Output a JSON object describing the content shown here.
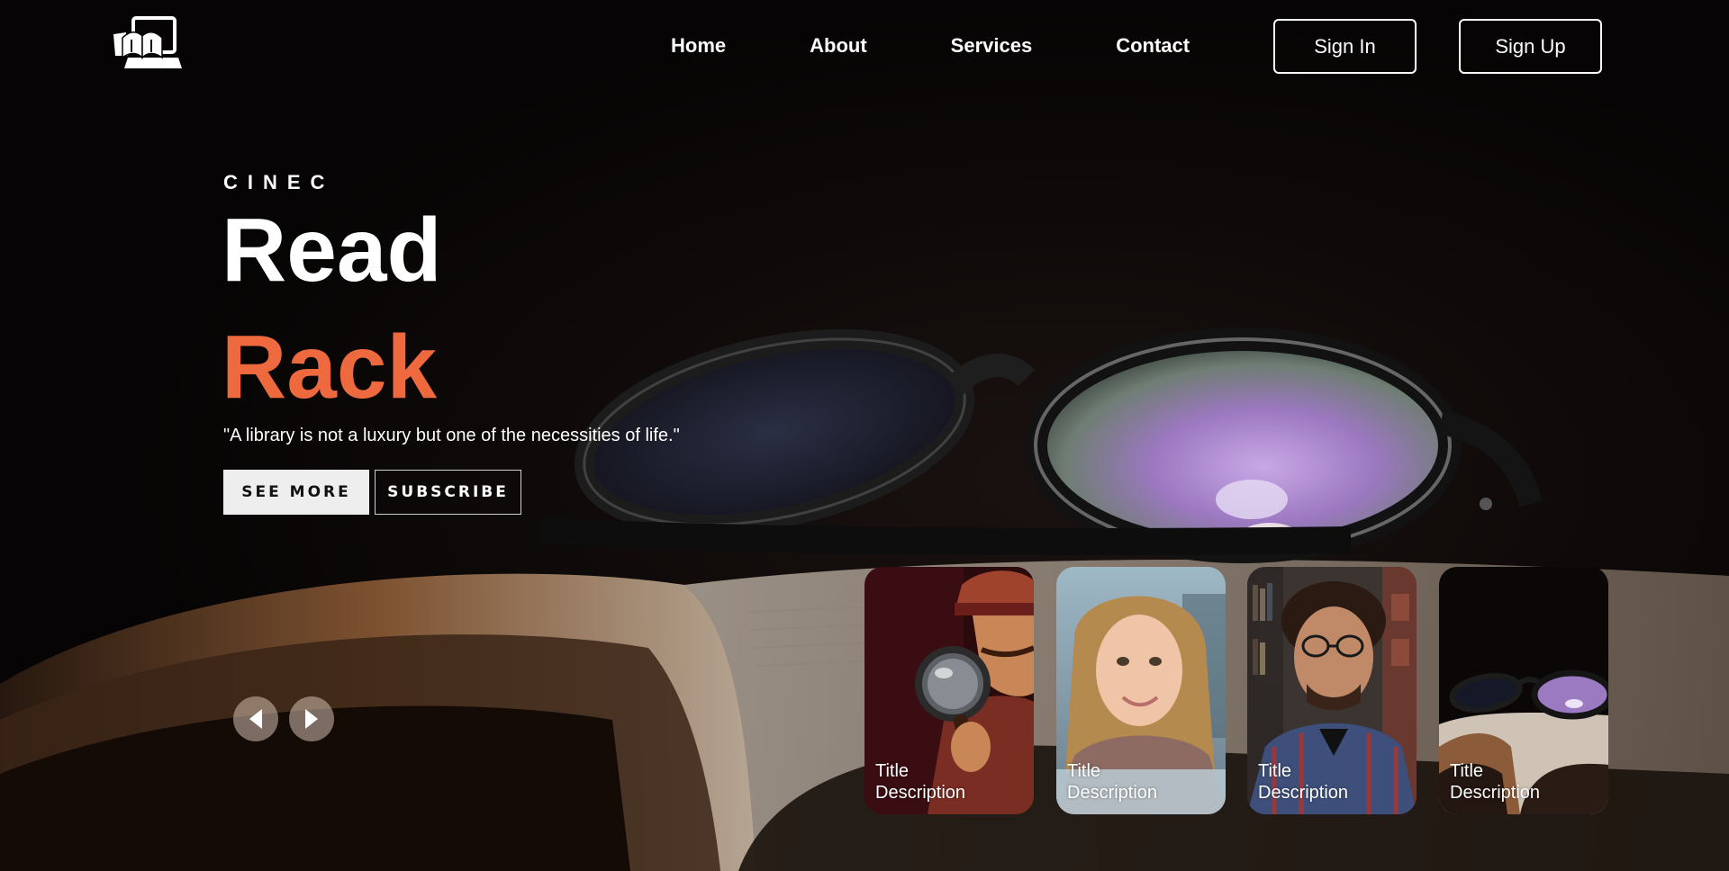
{
  "nav": {
    "items": [
      "Home",
      "About",
      "Services",
      "Contact"
    ]
  },
  "auth": {
    "sign_in": "Sign In",
    "sign_up": "Sign Up"
  },
  "hero": {
    "eyebrow": "CINEC",
    "title": "Read",
    "subtitle": "Rack",
    "quote": "\"A library is not a luxury but one of the necessities of life.\"",
    "see_more": "SEE MORE",
    "subscribe": "SUBSCRIBE"
  },
  "cards": [
    {
      "title": "Title",
      "description": "Description"
    },
    {
      "title": "Title",
      "description": "Description"
    },
    {
      "title": "Title",
      "description": "Description"
    },
    {
      "title": "Title",
      "description": "Description"
    }
  ],
  "colors": {
    "accent": "#ee6a3e",
    "background": "#060404",
    "text": "#ffffff"
  },
  "icons": {
    "logo": "library-books-laptop-icon",
    "prev": "chevron-left-icon",
    "next": "chevron-right-icon"
  }
}
